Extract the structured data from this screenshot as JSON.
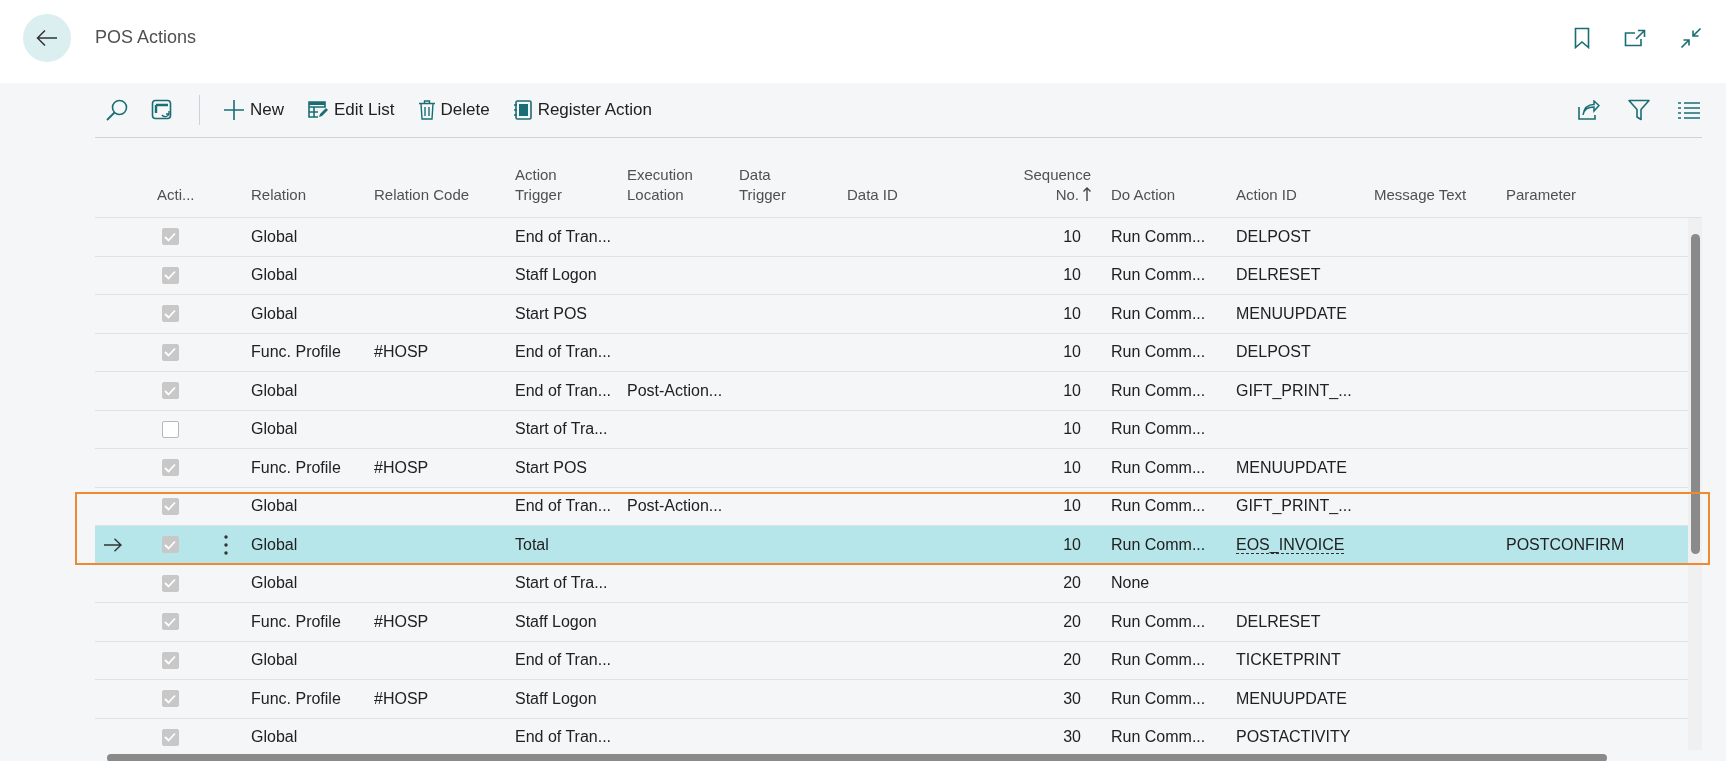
{
  "page": {
    "title": "POS Actions"
  },
  "toolbar": {
    "actions": [
      {
        "label": "New"
      },
      {
        "label": "Edit List"
      },
      {
        "label": "Delete"
      },
      {
        "label": "Register Action"
      }
    ]
  },
  "table": {
    "columns": [
      {
        "label": "Acti..."
      },
      {
        "label": "Relation"
      },
      {
        "label": "Relation Code"
      },
      {
        "label": "Action Trigger"
      },
      {
        "label": "Execution Location"
      },
      {
        "label": "Data Trigger"
      },
      {
        "label": "Data ID"
      },
      {
        "label": "Sequence No.",
        "sorted": true
      },
      {
        "label": "Do Action"
      },
      {
        "label": "Action ID"
      },
      {
        "label": "Message Text"
      },
      {
        "label": "Parameter"
      }
    ],
    "rows": [
      {
        "selected": false,
        "active": true,
        "relation": "Global",
        "action_trigger": "End of Tran...",
        "sequence_no": "10",
        "do_action": "Run Comm...",
        "action_id": "DELPOST"
      },
      {
        "selected": false,
        "active": true,
        "relation": "Global",
        "action_trigger": "Staff Logon",
        "sequence_no": "10",
        "do_action": "Run Comm...",
        "action_id": "DELRESET"
      },
      {
        "selected": false,
        "active": true,
        "relation": "Global",
        "action_trigger": "Start POS",
        "sequence_no": "10",
        "do_action": "Run Comm...",
        "action_id": "MENUUPDATE"
      },
      {
        "selected": false,
        "active": true,
        "relation": "Func. Profile",
        "relation_code": "#HOSP",
        "action_trigger": "End of Tran...",
        "sequence_no": "10",
        "do_action": "Run Comm...",
        "action_id": "DELPOST"
      },
      {
        "selected": false,
        "active": true,
        "relation": "Global",
        "action_trigger": "End of Tran...",
        "execution_location": "Post-Action...",
        "sequence_no": "10",
        "do_action": "Run Comm...",
        "action_id": "GIFT_PRINT_..."
      },
      {
        "selected": false,
        "active": false,
        "relation": "Global",
        "action_trigger": "Start of Tra...",
        "sequence_no": "10",
        "do_action": "Run Comm..."
      },
      {
        "selected": false,
        "active": true,
        "relation": "Func. Profile",
        "relation_code": "#HOSP",
        "action_trigger": "Start POS",
        "sequence_no": "10",
        "do_action": "Run Comm...",
        "action_id": "MENUUPDATE"
      },
      {
        "selected": false,
        "active": true,
        "relation": "Global",
        "action_trigger": "End of Tran...",
        "execution_location": "Post-Action...",
        "sequence_no": "10",
        "do_action": "Run Comm...",
        "action_id": "GIFT_PRINT_..."
      },
      {
        "selected": true,
        "active": true,
        "relation": "Global",
        "action_trigger": "Total",
        "sequence_no": "10",
        "do_action": "Run Comm...",
        "action_id": "EOS_INVOICE",
        "parameter": "POSTCONFIRM"
      },
      {
        "selected": false,
        "active": true,
        "relation": "Global",
        "action_trigger": "Start of Tra...",
        "sequence_no": "20",
        "do_action": "None"
      },
      {
        "selected": false,
        "active": true,
        "relation": "Func. Profile",
        "relation_code": "#HOSP",
        "action_trigger": "Staff Logon",
        "sequence_no": "20",
        "do_action": "Run Comm...",
        "action_id": "DELRESET"
      },
      {
        "selected": false,
        "active": true,
        "relation": "Global",
        "action_trigger": "End of Tran...",
        "sequence_no": "20",
        "do_action": "Run Comm...",
        "action_id": "TICKETPRINT"
      },
      {
        "selected": false,
        "active": true,
        "relation": "Func. Profile",
        "relation_code": "#HOSP",
        "action_trigger": "Staff Logon",
        "sequence_no": "30",
        "do_action": "Run Comm...",
        "action_id": "MENUUPDATE"
      },
      {
        "selected": false,
        "active": true,
        "relation": "Global",
        "action_trigger": "End of Tran...",
        "sequence_no": "30",
        "do_action": "Run Comm...",
        "action_id": "POSTACTIVITY"
      }
    ]
  }
}
